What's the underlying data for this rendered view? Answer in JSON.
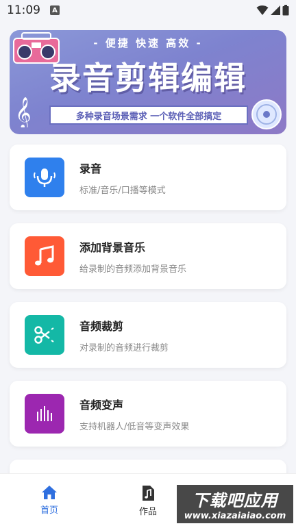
{
  "status_bar": {
    "time": "11:09",
    "notification_glyph": "A"
  },
  "banner": {
    "subtitle": "- 便捷 快速 高效 -",
    "title": "录音剪辑编辑",
    "slogan": "多种录音场景需求  一个软件全部搞定"
  },
  "features": [
    {
      "title": "录音",
      "desc": "标准/音乐/口播等模式",
      "icon": "microphone-icon",
      "color": "#2f80ed"
    },
    {
      "title": "添加背景音乐",
      "desc": "给录制的音频添加背景音乐",
      "icon": "music-note-icon",
      "color": "#ff5a36"
    },
    {
      "title": "音频裁剪",
      "desc": "对录制的音频进行裁剪",
      "icon": "scissors-icon",
      "color": "#14b8a6"
    },
    {
      "title": "音频变声",
      "desc": "支持机器人/低音等变声效果",
      "icon": "sound-bars-icon",
      "color": "#9c27b0"
    }
  ],
  "bottom_nav": {
    "items": [
      {
        "label": "首页",
        "icon": "home-icon",
        "active": true
      },
      {
        "label": "作品",
        "icon": "music-file-icon",
        "active": false
      }
    ],
    "active_color": "#2f6fdf",
    "inactive_color": "#333333"
  },
  "watermark": {
    "main": "下载吧应用",
    "url": "www.xiazaiaiao.com"
  }
}
